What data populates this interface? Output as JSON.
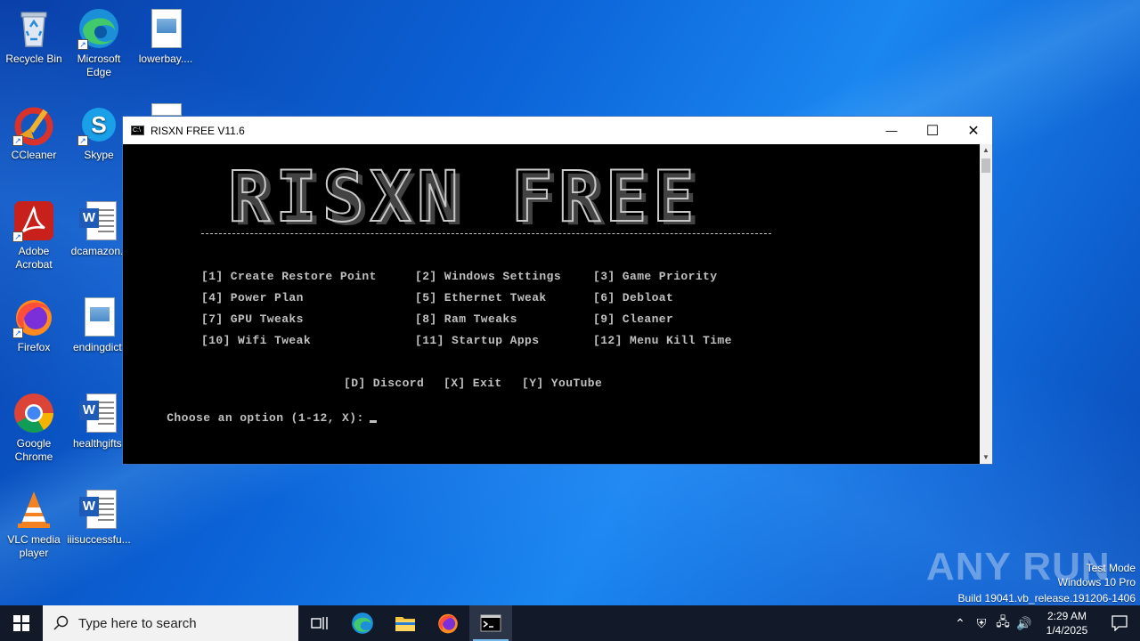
{
  "desktop": {
    "icons": [
      {
        "label": "Recycle Bin"
      },
      {
        "label": "Microsoft Edge"
      },
      {
        "label": "lowerbay...."
      },
      {
        "label": "CCleaner"
      },
      {
        "label": "Skype"
      },
      {
        "label": "Adobe Acrobat"
      },
      {
        "label": "dcamazon.r"
      },
      {
        "label": "Firefox"
      },
      {
        "label": "endingdict."
      },
      {
        "label": "Google Chrome"
      },
      {
        "label": "healthgifts."
      },
      {
        "label": "VLC media player"
      },
      {
        "label": "iiisuccessfu..."
      }
    ]
  },
  "window": {
    "title": "RISXN FREE V11.6",
    "minimize_icon": "—",
    "maximize_icon": "☐",
    "close_icon": "✕"
  },
  "console": {
    "banner": "RISXN FREE",
    "options": [
      "[1] Create Restore Point",
      "[2] Windows Settings",
      "[3] Game Priority",
      "[4] Power Plan",
      "[5] Ethernet Tweak",
      "[6] Debloat",
      "[7] GPU Tweaks",
      "[8] Ram Tweaks",
      "[9] Cleaner",
      "[10] Wifi Tweak",
      "[11] Startup Apps",
      "[12] Menu Kill Time"
    ],
    "extras": [
      "[D] Discord",
      "[X] Exit",
      "[Y] YouTube"
    ],
    "prompt": "Choose an option (1-12, X):"
  },
  "watermark": {
    "brand": "ANY RUN",
    "mode": "Test Mode",
    "edition": "Windows 10 Pro",
    "build": "Build 19041.vb_release.191206-1406"
  },
  "taskbar": {
    "search_placeholder": "Type here to search",
    "time": "2:29 AM",
    "date": "1/4/2025"
  },
  "colors": {
    "console_text": "#c0c0c0",
    "taskbar_bg": "#121a2a",
    "accent": "#76b9ed"
  }
}
